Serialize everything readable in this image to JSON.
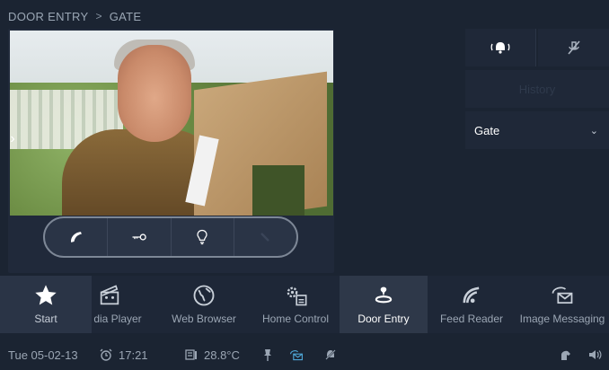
{
  "breadcrumb": {
    "section": "DOOR ENTRY",
    "separator": ">",
    "current": "GATE"
  },
  "video": {
    "handle_arrow": "›"
  },
  "controls": [
    {
      "name": "call-button",
      "icon": "phone-icon"
    },
    {
      "name": "unlock-button",
      "icon": "key-icon"
    },
    {
      "name": "light-button",
      "icon": "bulb-icon"
    },
    {
      "name": "disabled-button",
      "icon": "wrench-icon"
    }
  ],
  "right_panel": {
    "wide_button_label": "History",
    "select_value": "Gate",
    "select_chevron": "⌄"
  },
  "apps": [
    {
      "label": "Start"
    },
    {
      "label": "dia Player"
    },
    {
      "label": "Web Browser"
    },
    {
      "label": "Home Control"
    },
    {
      "label": "Door Entry"
    },
    {
      "label": "Feed Reader"
    },
    {
      "label": "Image Messaging"
    }
  ],
  "status": {
    "date": "Tue 05-02-13",
    "time": "17:21",
    "temperature": "28.8°C"
  },
  "colors": {
    "background": "#1b2432",
    "panel": "#1f2838",
    "active_tab": "#2e3849",
    "accent": "#4fa8d8"
  }
}
